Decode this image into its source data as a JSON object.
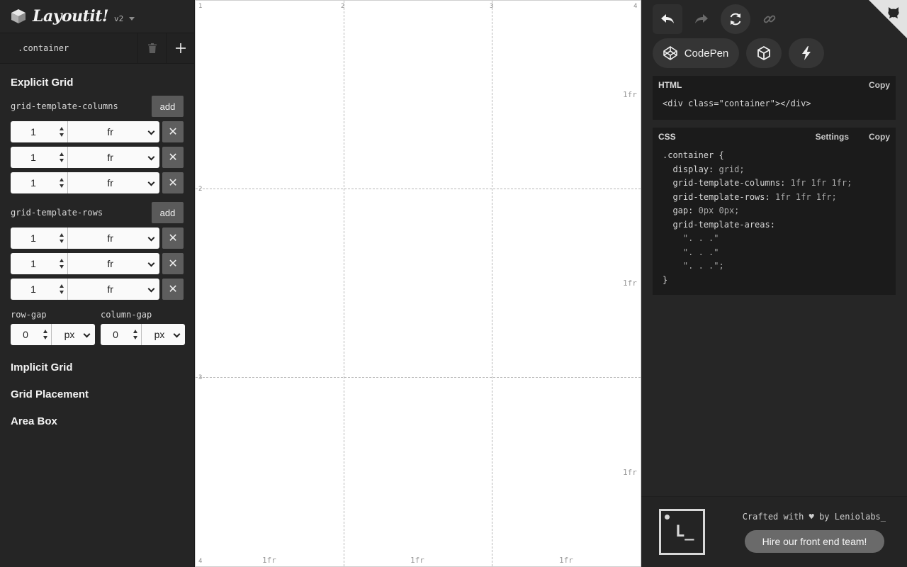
{
  "brand": {
    "name": "Layoutit!",
    "version": "v2"
  },
  "container": {
    "selector": ".container"
  },
  "explicit_grid": {
    "title": "Explicit Grid",
    "columns_label": "grid-template-columns",
    "rows_label": "grid-template-rows",
    "add_label": "add",
    "delete_glyph": "✕",
    "columns": [
      {
        "value": "1",
        "unit": "fr"
      },
      {
        "value": "1",
        "unit": "fr"
      },
      {
        "value": "1",
        "unit": "fr"
      }
    ],
    "rows": [
      {
        "value": "1",
        "unit": "fr"
      },
      {
        "value": "1",
        "unit": "fr"
      },
      {
        "value": "1",
        "unit": "fr"
      }
    ],
    "row_gap": {
      "label": "row-gap",
      "value": "0",
      "unit": "px"
    },
    "column_gap": {
      "label": "column-gap",
      "value": "0",
      "unit": "px"
    }
  },
  "sections": [
    "Implicit Grid",
    "Grid Placement",
    "Area Box"
  ],
  "canvas": {
    "col_line_numbers": [
      "1",
      "2",
      "3",
      "4"
    ],
    "row_line_numbers": [
      "2",
      "3",
      "4"
    ],
    "col_sizes": [
      "1fr",
      "1fr",
      "1fr"
    ],
    "row_sizes": [
      "1fr",
      "1fr",
      "1fr"
    ]
  },
  "toolbar": {
    "icons": [
      "undo-icon",
      "redo-icon",
      "reset-icon",
      "link-icon"
    ],
    "codepen_label": "CodePen",
    "extra_icons": [
      "codesandbox-icon",
      "bolt-icon"
    ]
  },
  "html_panel": {
    "title": "HTML",
    "copy_label": "Copy",
    "code": "<div class=\"container\"></div>"
  },
  "css_panel": {
    "title": "CSS",
    "settings_label": "Settings",
    "copy_label": "Copy",
    "selector_line": ".container {",
    "lines": [
      {
        "prop": "display:",
        "value": "grid;"
      },
      {
        "prop": "grid-template-columns:",
        "value": "1fr 1fr 1fr;"
      },
      {
        "prop": "grid-template-rows:",
        "value": "1fr 1fr 1fr;"
      },
      {
        "prop": "gap:",
        "value": "0px 0px;"
      },
      {
        "prop": "grid-template-areas:",
        "value": ""
      }
    ],
    "areas": [
      "\". . .\"",
      "\". . .\"",
      "\". . .\";"
    ],
    "close": "}"
  },
  "footer": {
    "crafted": "Crafted with ♥ by Leniolabs_",
    "hire_label": "Hire our front end team!"
  },
  "colors": {
    "sidebar_bg": "#252525",
    "panel_bg": "#262626",
    "code_bg": "#1b1b1b",
    "canvas_bg": "#ffffff",
    "button_gray": "#5a5a5a"
  }
}
